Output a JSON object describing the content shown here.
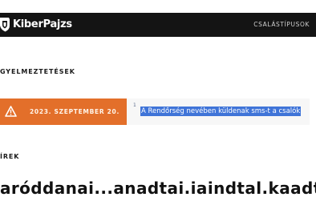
{
  "header": {
    "brand": "KiberPajzs",
    "nav_link": "CSALÁSTÍPUSOK",
    "logo_icon": "shield-icon",
    "background": "#141414"
  },
  "warnings": {
    "title": "GYELMEZTETÉSEK",
    "alert": {
      "icon": "warning-triangle-icon",
      "date": "2023. SZEPTEMBER 20.",
      "index": "1",
      "link_text": "A Rendőrség nevében küldenak sms-t a csalók",
      "accent": "#e36f2a",
      "highlight": "#3f74d8"
    }
  },
  "news": {
    "title": "ÍREK",
    "headline": "aróddanai...anadtai.iaindtal.kaadtái.a.iainahk"
  }
}
